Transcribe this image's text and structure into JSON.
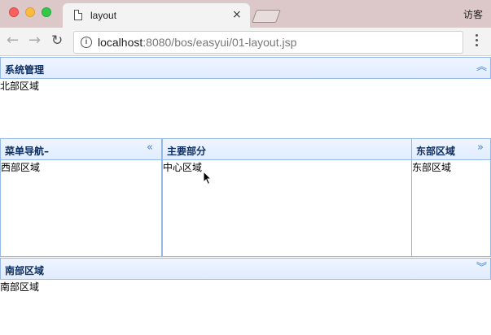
{
  "browser": {
    "tab_title": "layout",
    "tab_close": "×",
    "guest_label": "访客",
    "url_host": "localhost",
    "url_rest": ":8080/bos/easyui/01-layout.jsp",
    "info_icon": "i",
    "back_icon": "←",
    "forward_icon": "→",
    "reload_icon": "↻"
  },
  "layout": {
    "north": {
      "title": "系统管理",
      "body": "北部区域",
      "tool_icon": "︽"
    },
    "west": {
      "title": "菜单导航–",
      "body": "西部区域",
      "tool_icon": "«"
    },
    "center": {
      "title": "主要部分",
      "body": "中心区域"
    },
    "east": {
      "title": "东部区域",
      "body": "东部区域",
      "tool_icon": "»"
    },
    "south": {
      "title": "南部区域",
      "body": "南部区域",
      "tool_icon": "︾"
    }
  },
  "colors": {
    "header_border": "#95b8e7",
    "header_title": "#0e2d5f",
    "tool_icon": "#4b82c9"
  }
}
